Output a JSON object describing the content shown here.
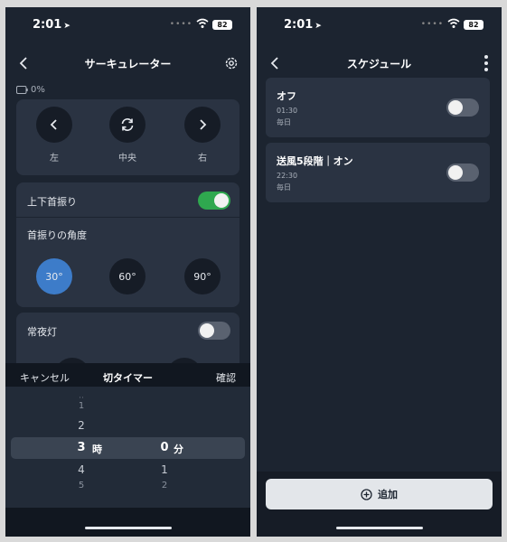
{
  "colors": {
    "background": "#1c2430",
    "card": "#2a3342",
    "accent_blue": "#3d7cc9",
    "toggle_on": "#2fa84f"
  },
  "left": {
    "status": {
      "time": "2:01",
      "battery": "82"
    },
    "header": {
      "title": "サーキュレーター",
      "back_icon": "chevron-left-icon",
      "settings_icon": "gear-icon"
    },
    "battery_level": "0%",
    "direction": {
      "left_label": "左",
      "center_label": "中央",
      "right_label": "右"
    },
    "swing": {
      "label": "上下首振り",
      "enabled": true,
      "angle_label": "首振りの角度",
      "angles": [
        "30°",
        "60°",
        "90°"
      ],
      "selected_angle": "30°"
    },
    "night_light": {
      "label": "常夜灯",
      "enabled": false
    },
    "timer_sheet": {
      "cancel": "キャンセル",
      "title": "切タイマー",
      "confirm": "確認",
      "hours": [
        "1",
        "2",
        "3",
        "4",
        "5"
      ],
      "hour_selected": "3",
      "hour_unit": "時",
      "minutes": [
        "0",
        "1",
        "2"
      ],
      "minute_selected": "0",
      "minute_unit": "分"
    }
  },
  "right": {
    "status": {
      "time": "2:01",
      "battery": "82"
    },
    "header": {
      "title": "スケジュール",
      "back_icon": "chevron-left-icon",
      "more_icon": "more-vertical-icon"
    },
    "schedules": [
      {
        "title": "オフ",
        "time": "01:30",
        "days": "毎日",
        "enabled": false
      },
      {
        "title": "送風5段階｜オン",
        "time": "22:30",
        "days": "毎日",
        "enabled": false
      }
    ],
    "add_label": "追加"
  }
}
